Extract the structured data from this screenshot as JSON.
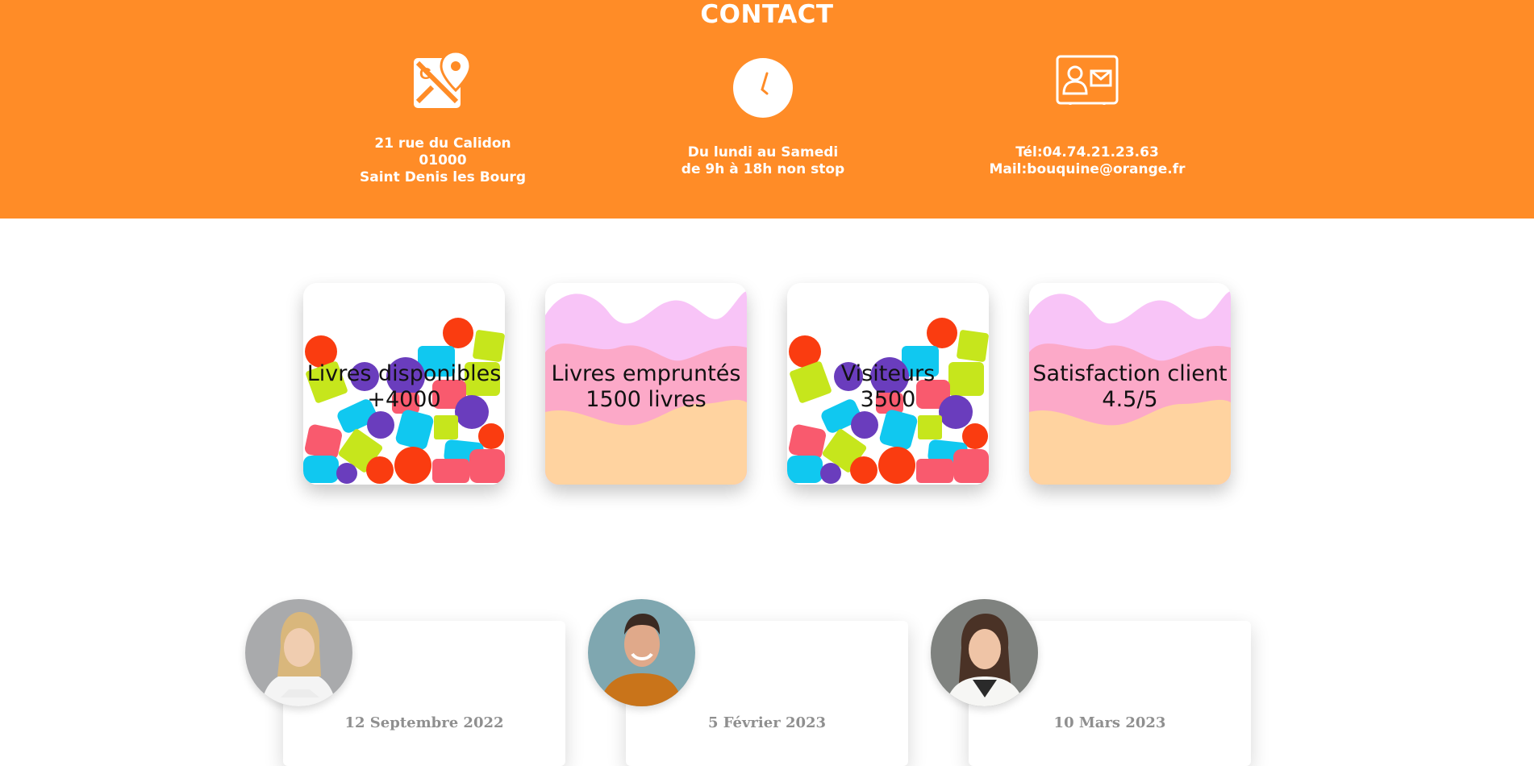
{
  "contact": {
    "title": "CONTACT",
    "address": {
      "icon": "google-maps-icon",
      "lines": [
        "21 rue du Calidon",
        "01000",
        "Saint Denis les Bourg"
      ]
    },
    "hours": {
      "icon": "clock-icon",
      "lines": [
        "Du lundi au Samedi",
        "de 9h à 18h non stop"
      ]
    },
    "reach": {
      "icon": "contact-card-icon",
      "lines": [
        "Tél:04.74.21.23.63",
        "Mail:bouquine@orange.fr"
      ]
    }
  },
  "stats": [
    {
      "title": "Livres disponibles",
      "value": "+4000",
      "background": "colorful-shapes"
    },
    {
      "title": "Livres empruntés",
      "value": "1500 livres",
      "background": "pastel-waves"
    },
    {
      "title": "Visiteurs",
      "value": "3500",
      "background": "colorful-shapes"
    },
    {
      "title": "Satisfaction client",
      "value": "4.5/5",
      "background": "pastel-waves"
    }
  ],
  "team": [
    {
      "date": "12 Septembre 2022",
      "avatar": "woman-blonde-avatar"
    },
    {
      "date": "5 Février 2023",
      "avatar": "man-smiling-avatar"
    },
    {
      "date": "10 Mars 2023",
      "avatar": "woman-brunette-avatar"
    }
  ],
  "colors": {
    "brand_orange": "#ff8c27",
    "text_white": "#ffffff",
    "stat_text": "#111111",
    "date_gray": "#8f8f8f"
  }
}
